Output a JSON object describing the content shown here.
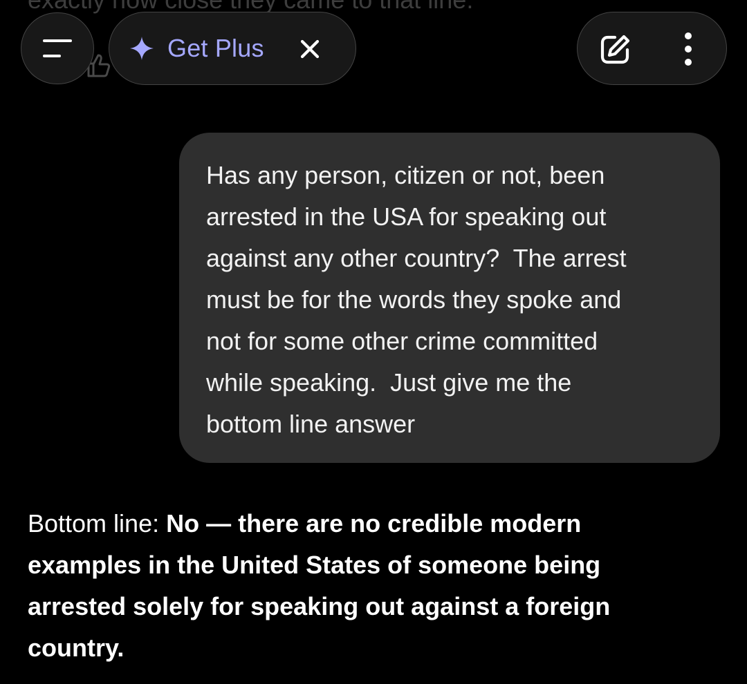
{
  "header": {
    "upgrade_label": "Get Plus",
    "icons": {
      "menu": "menu-icon",
      "sparkle": "sparkle-icon",
      "close": "close-icon",
      "new_chat": "edit-icon",
      "more": "more-vertical-icon",
      "like": "thumbs-up-icon"
    }
  },
  "previous_message_fragment": "exactly how close they came to that line.",
  "user_message": {
    "lines": [
      "Has any person, citizen or not, been",
      "arrested in the USA for speaking out",
      "against any other country?  The arrest",
      "must be for the words they spoke and",
      "not for some other crime committed",
      "while speaking.  Just give me the",
      "bottom line answer"
    ]
  },
  "assistant_message": {
    "lead": "Bottom line: ",
    "lines": [
      "No — there are no credible modern",
      "examples in the United States of someone being",
      "arrested solely for speaking out against a foreign",
      "country."
    ]
  },
  "colors": {
    "background": "#000000",
    "pill_background": "#181818",
    "pill_border": "#444444",
    "accent": "#a5a8ff",
    "bubble": "#2f2f2f"
  }
}
